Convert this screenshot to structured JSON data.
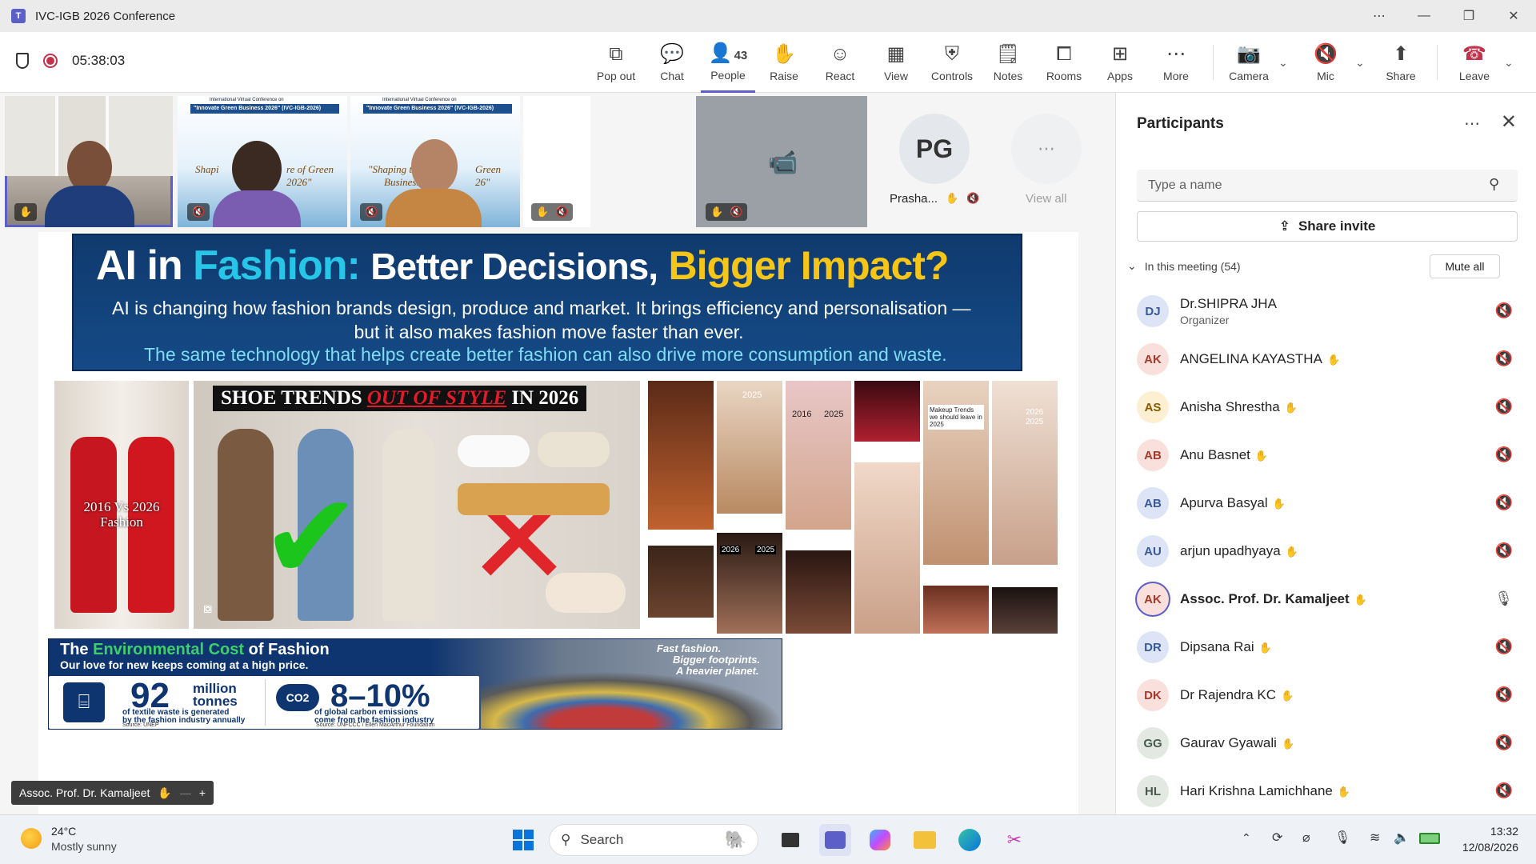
{
  "window": {
    "title": "IVC-IGB 2026 Conference"
  },
  "toolbar": {
    "timer": "05:38:03",
    "buttons": {
      "popout": "Pop out",
      "chat": "Chat",
      "people": "People",
      "people_count": "43",
      "raise": "Raise",
      "react": "React",
      "view": "View",
      "controls": "Controls",
      "notes": "Notes",
      "rooms": "Rooms",
      "apps": "Apps",
      "more": "More",
      "camera": "Camera",
      "mic": "Mic",
      "share": "Share",
      "leave": "Leave"
    }
  },
  "video_strip": {
    "pg_initials": "PG",
    "pg_name": "Prasha...",
    "view_all": "View all",
    "slide_title": "International Virtual Conference on",
    "slide_subtitle": "\"Innovate Green Business 2026\" (IVC-IGB-2026)",
    "slide_tag_left": "Shapi",
    "slide_tag_left2": "re of Green",
    "slide_tag_left3": "2026\"",
    "slide_tag_right": "\"Shaping the f",
    "slide_tag_right2": "Green",
    "slide_tag_right3": "Business: I",
    "slide_tag_right4": "26\""
  },
  "slide": {
    "banner": {
      "title_ai": "AI in",
      "title_fashion": "Fashion:",
      "title_better": "Better Decisions,",
      "title_bigger": "Bigger Impact?",
      "line1": "AI is changing how fashion brands design, produce and market. It brings efficiency and personalisation —",
      "line2": "but it also makes fashion move faster than ever.",
      "line3": "The same technology that helps create better fashion can also drive more consumption and waste."
    },
    "fashion_caption": "2016 Vs 2026\nFashion",
    "shoe": {
      "pre": "SHOE TRENDS",
      "mid": "OUT OF STYLE",
      "post": "IN 2026"
    },
    "env": {
      "title_a": "The",
      "title_b": "Environmental Cost",
      "title_c": "of Fashion",
      "subtitle": "Our love for new keeps coming at a high price.",
      "stat1_value": "92",
      "stat1_unit1": "million",
      "stat1_unit2": "tonnes",
      "stat1_desc1": "of textile waste is generated",
      "stat1_desc2": "by the fashion industry annually",
      "stat1_source": "Source: UNEP",
      "co2_label": "CO2",
      "stat2_value": "8–10%",
      "stat2_desc1": "of global carbon emissions",
      "stat2_desc2": "come from the fashion industry",
      "stat2_source": "Source: UNFCCC / Ellen MacArthur Foundation",
      "fast1": "Fast fashion.",
      "fast2": "Bigger footprints.",
      "fast3": "A heavier planet."
    },
    "collage_labels": [
      "2025",
      "2016",
      "2025",
      "2026",
      "2025",
      "2025",
      "2026",
      "Makeup Trends we should leave in 2025"
    ]
  },
  "speaker_label": "Assoc. Prof. Dr. Kamaljeet",
  "participants": {
    "title": "Participants",
    "search_placeholder": "Type a name",
    "share_invite": "Share invite",
    "in_meeting": "In this meeting (54)",
    "mute_all": "Mute all",
    "list": [
      {
        "initials": "DJ",
        "name": "Dr.SHIPRA JHA",
        "role": "Organizer",
        "bg": "#dce4f5",
        "fg": "#3a5a97"
      },
      {
        "initials": "AK",
        "name": "ANGELINA KAYASTHA",
        "role": "",
        "bg": "#f9e0dc",
        "fg": "#a33b2b"
      },
      {
        "initials": "AS",
        "name": "Anisha Shrestha",
        "role": "",
        "bg": "#fcefd2",
        "fg": "#8a5a00"
      },
      {
        "initials": "AB",
        "name": "Anu Basnet",
        "role": "",
        "bg": "#f9e0dc",
        "fg": "#a33b2b"
      },
      {
        "initials": "AB",
        "name": "Apurva Basyal",
        "role": "",
        "bg": "#dce4f5",
        "fg": "#3a5a97"
      },
      {
        "initials": "AU",
        "name": "arjun upadhyaya",
        "role": "",
        "bg": "#dce4f5",
        "fg": "#3a5a97"
      },
      {
        "initials": "AK",
        "name": "Assoc. Prof. Dr. Kamaljeet",
        "role": "",
        "bg": "#f9e0dc",
        "fg": "#a33b2b"
      },
      {
        "initials": "DR",
        "name": "Dipsana Rai",
        "role": "",
        "bg": "#dce4f5",
        "fg": "#3a5a97"
      },
      {
        "initials": "DK",
        "name": "Dr Rajendra KC",
        "role": "",
        "bg": "#f9e0dc",
        "fg": "#a33b2b"
      },
      {
        "initials": "GG",
        "name": "Gaurav Gyawali",
        "role": "",
        "bg": "#e3e8e3",
        "fg": "#4a5a4a"
      },
      {
        "initials": "HL",
        "name": "Hari Krishna Lamichhane",
        "role": "",
        "bg": "#e3e8e3",
        "fg": "#4a5a4a"
      }
    ]
  },
  "taskbar": {
    "weather_temp": "24°C",
    "weather_desc": "Mostly sunny",
    "search": "Search",
    "time": "13:32",
    "date": "12/08/2026"
  },
  "colors": {
    "accent": "#5b5fc7",
    "leave": "#c4314b",
    "banner_bg": "#123a6b",
    "highlight_yellow": "#f5c518",
    "fashion_cyan": "#27c5e8"
  }
}
